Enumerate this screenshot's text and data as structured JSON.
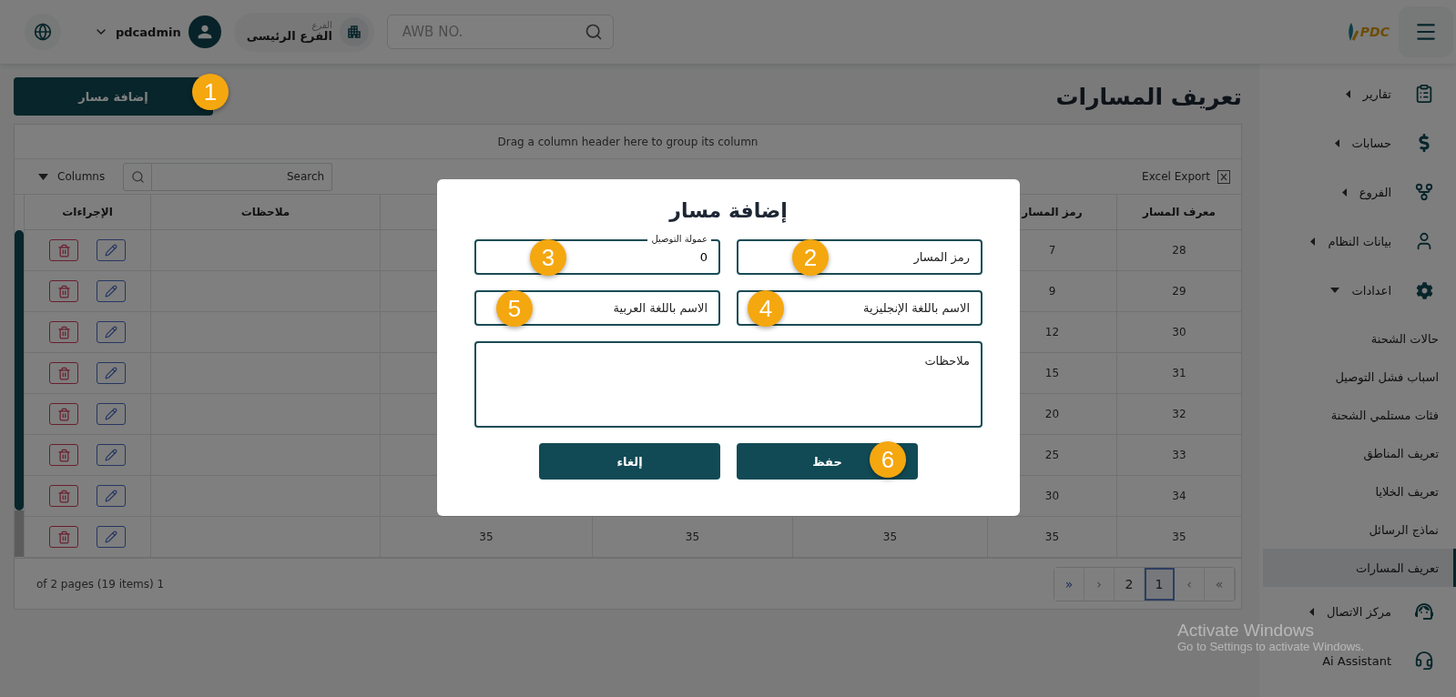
{
  "header": {
    "logo_text": "PDC",
    "search": {
      "placeholder": "AWB NO."
    },
    "branch": {
      "label": "الفرع",
      "value": "الفرع الرئيسى"
    },
    "user": {
      "name": "pdcadmin"
    }
  },
  "sidebar": {
    "items": [
      {
        "kind": "group",
        "label": "تقارير",
        "expanded": false
      },
      {
        "kind": "group",
        "label": "حسابات",
        "expanded": false
      },
      {
        "kind": "group",
        "label": "الفروع",
        "expanded": false
      },
      {
        "kind": "group",
        "label": "بيانات النظام",
        "expanded": false
      },
      {
        "kind": "group",
        "label": "اعدادات",
        "expanded": true,
        "children": [
          {
            "label": "حالات الشحنة",
            "selected": false
          },
          {
            "label": "اسباب فشل التوصيل",
            "selected": false
          },
          {
            "label": "فئات مستلمي الشحنة",
            "selected": false
          },
          {
            "label": "تعريف المناطق",
            "selected": false
          },
          {
            "label": "تعريف الخلايا",
            "selected": false
          },
          {
            "label": "نماذج الرسائل",
            "selected": false
          },
          {
            "label": "تعريف المسارات",
            "selected": true
          }
        ]
      },
      {
        "kind": "group",
        "label": "مركز الاتصال",
        "expanded": false
      },
      {
        "kind": "link",
        "label": "Ai Assistant"
      }
    ]
  },
  "page": {
    "title": "تعريف المسارات",
    "add_button": {
      "label": "إضافة مسار",
      "badge": "1"
    }
  },
  "grid": {
    "group_panel": "Drag a column header here to group its column",
    "toolbar": {
      "columns_label": "Columns",
      "search_placeholder": "Search",
      "export_label": "Excel Export"
    },
    "columns": [
      "معرف المسار",
      "رمز المسار",
      null,
      null,
      null,
      "ملاحظات",
      "الإجراءات"
    ],
    "rows": [
      {
        "cells": [
          "28",
          "7",
          null,
          null,
          null,
          null
        ]
      },
      {
        "cells": [
          "29",
          "9",
          null,
          null,
          null,
          null
        ]
      },
      {
        "cells": [
          "30",
          "12",
          null,
          null,
          null,
          null
        ]
      },
      {
        "cells": [
          "31",
          "15",
          null,
          null,
          null,
          null
        ]
      },
      {
        "cells": [
          "32",
          "20",
          null,
          null,
          null,
          null
        ]
      },
      {
        "cells": [
          "33",
          "25",
          null,
          null,
          null,
          null
        ]
      },
      {
        "cells": [
          "34",
          "30",
          null,
          null,
          null,
          null
        ]
      },
      {
        "cells": [
          "35",
          "35",
          "35",
          "35",
          "35",
          null
        ]
      }
    ],
    "pager": {
      "summary": "of 2 pages (19 items) 1",
      "buttons": [
        {
          "label": "»",
          "selected": false,
          "disabled": true
        },
        {
          "label": "›",
          "selected": false,
          "disabled": true
        },
        {
          "label": "1",
          "selected": true,
          "disabled": false
        },
        {
          "label": "2",
          "selected": false,
          "disabled": false
        },
        {
          "label": "‹",
          "selected": false,
          "disabled": true
        },
        {
          "label": "«",
          "selected": false,
          "disabled": false
        }
      ]
    }
  },
  "dialog": {
    "title": "إضافة مسار",
    "field_rows": [
      [
        {
          "kind": "input",
          "placeholder": "رمز المسار",
          "badge": "2"
        },
        {
          "kind": "input",
          "label": "عمولة التوصيل",
          "value": "0",
          "badge": "3"
        }
      ],
      [
        {
          "kind": "input",
          "placeholder": "الاسم باللغة الإنجليزية",
          "badge": "4"
        },
        {
          "kind": "input",
          "placeholder": "الاسم باللغة العربية",
          "badge": "5"
        }
      ],
      [
        {
          "kind": "textarea",
          "placeholder": "ملاحظات"
        }
      ]
    ],
    "buttons": [
      {
        "label": "حفظ",
        "badge": "6"
      },
      {
        "label": "إلغاء"
      }
    ]
  },
  "os_notice": {
    "title": "Activate Windows",
    "subtitle": "Go to Settings to activate Windows."
  }
}
